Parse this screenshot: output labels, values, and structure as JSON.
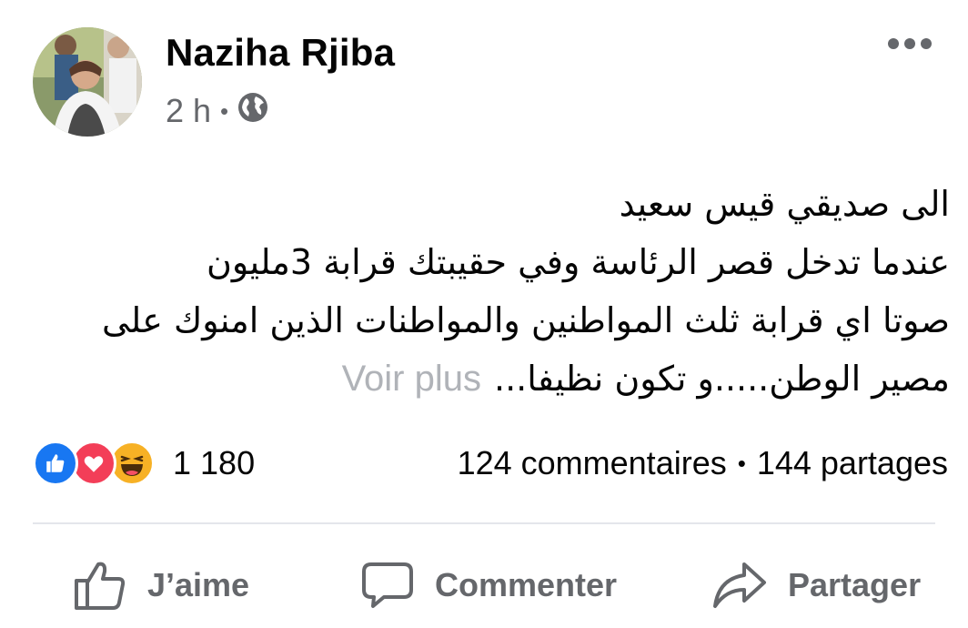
{
  "post": {
    "author": "Naziha Rjiba",
    "time": "2 h",
    "audience_icon": "globe-icon",
    "body_lines": [
      "الى صديقي قيس سعيد",
      "عندما  تدخل قصر الرئاسة وفي حقيبتك قرابة 3مليون",
      "صوتا اي قرابة ثلث المواطنين والمواطنات الذين امنوك على",
      "مصير الوطن.....و تكون نظيفا..."
    ],
    "see_more": "Voir plus"
  },
  "reactions": {
    "icons": [
      "like-reaction-icon",
      "love-reaction-icon",
      "haha-reaction-icon"
    ],
    "count": "1 180"
  },
  "stats": {
    "comments": "124 commentaires",
    "separator": "•",
    "shares": "144 partages"
  },
  "actions": {
    "like": "J’aime",
    "comment": "Commenter",
    "share": "Partager"
  },
  "colors": {
    "text": "#050505",
    "secondary": "#65676b",
    "like_blue": "#1877f2",
    "love_red": "#f33e58",
    "haha_yellow": "#f7b125",
    "divider": "#e4e6eb"
  }
}
